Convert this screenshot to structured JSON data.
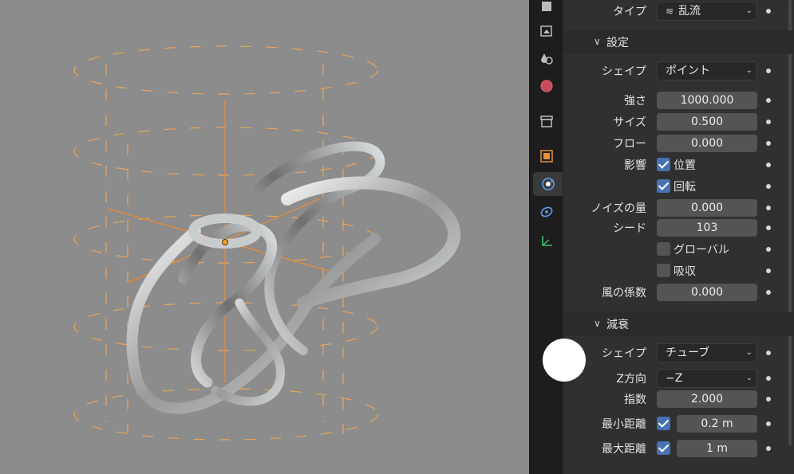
{
  "viewport": {
    "label": "3d-viewport"
  },
  "tabs": [
    {
      "icon": "scene-icon"
    },
    {
      "icon": "output-icon"
    },
    {
      "icon": "view-layer-icon"
    },
    {
      "icon": "world-icon"
    },
    {
      "icon": "collection-icon"
    },
    {
      "icon": "object-icon"
    },
    {
      "icon": "physics-icon"
    },
    {
      "icon": "constraints-icon"
    },
    {
      "icon": "data-icon"
    }
  ],
  "field": {
    "type_label": "タイプ",
    "type_value": "乱流",
    "settings_title": "設定",
    "shape_label": "シェイプ",
    "shape_value": "ポイント",
    "strength_label": "強さ",
    "strength_value": "1000.000",
    "size_label": "サイズ",
    "size_value": "0.500",
    "flow_label": "フロー",
    "flow_value": "0.000",
    "affect_label": "影響",
    "affect_location": "位置",
    "affect_rotation": "回転",
    "noise_label": "ノイズの量",
    "noise_value": "0.000",
    "seed_label": "シード",
    "seed_value": "103",
    "global_label": "グローバル",
    "absorb_label": "吸収",
    "wind_label": "風の係数",
    "wind_value": "0.000"
  },
  "falloff": {
    "title": "減衰",
    "shape_label": "シェイプ",
    "shape_value": "チューブ",
    "z_label": "Z方向",
    "z_value": "−Z",
    "power_label": "指数",
    "power_value": "2.000",
    "min_label": "最小距離",
    "min_value": "0.2 m",
    "max_label": "最大距離",
    "max_value": "1 m"
  },
  "colors": {
    "accent": "#4772b3",
    "panel": "#303030",
    "field": "#545454",
    "wire": "#e8a65a"
  }
}
